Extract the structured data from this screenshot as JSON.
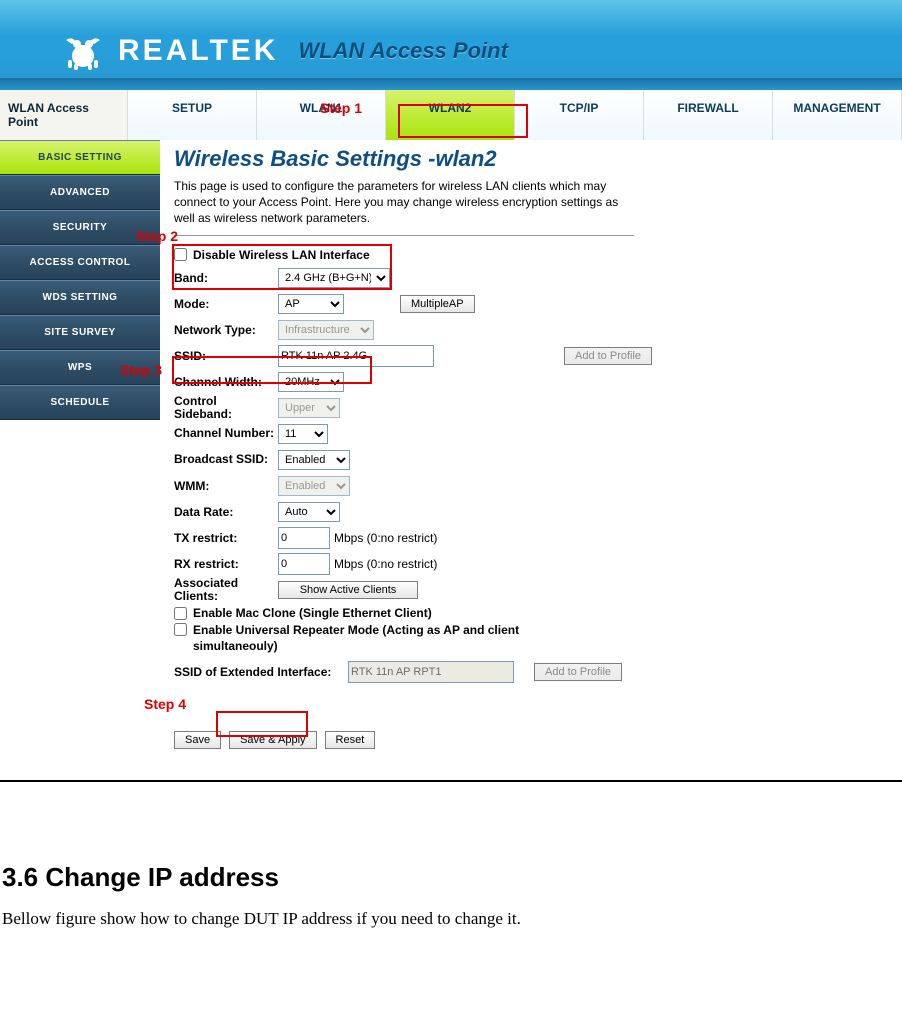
{
  "banner": {
    "brand": "REALTEK",
    "tagline": "WLAN Access Point"
  },
  "topnav": {
    "side_title": "WLAN Access Point",
    "tabs": [
      "SETUP",
      "WLAN1",
      "WLAN2",
      "TCP/IP",
      "FIREWALL",
      "MANAGEMENT"
    ]
  },
  "sidebar": {
    "items": [
      "BASIC SETTING",
      "ADVANCED",
      "SECURITY",
      "ACCESS CONTROL",
      "WDS SETTING",
      "SITE SURVEY",
      "WPS",
      "SCHEDULE"
    ]
  },
  "page": {
    "title": "Wireless Basic Settings -wlan2",
    "desc": "This page is used to configure the parameters for wireless LAN clients which may connect to your Access Point. Here you may change wireless encryption settings as well as wireless network parameters.",
    "disable_label": "Disable Wireless LAN Interface",
    "band_label": "Band:",
    "band_value": "2.4 GHz (B+G+N)",
    "mode_label": "Mode:",
    "mode_value": "AP",
    "multiple_ap": "MultipleAP",
    "nettype_label": "Network Type:",
    "nettype_value": "Infrastructure",
    "ssid_label": "SSID:",
    "ssid_value": "RTK 11n AP 2.4G",
    "add_to_profile": "Add to Profile",
    "chanw_label": "Channel Width:",
    "chanw_value": "20MHz",
    "sideband_label": "Control Sideband:",
    "sideband_value": "Upper",
    "channum_label": "Channel Number:",
    "channum_value": "11",
    "bssid_label": "Broadcast SSID:",
    "bssid_value": "Enabled",
    "wmm_label": "WMM:",
    "wmm_value": "Enabled",
    "rate_label": "Data Rate:",
    "rate_value": "Auto",
    "tx_label": "TX restrict:",
    "rx_label": "RX restrict:",
    "tx_value": "0",
    "rx_value": "0",
    "restrict_hint": "Mbps (0:no restrict)",
    "assoc_label": "Associated Clients:",
    "show_clients": "Show Active Clients",
    "macclone_label": "Enable Mac Clone (Single Ethernet Client)",
    "urepeater_label": "Enable Universal Repeater Mode (Acting as AP and client simultaneouly)",
    "ext_ssid_label": "SSID of Extended Interface:",
    "ext_ssid_value": "RTK 11n AP RPT1",
    "save": "Save",
    "save_apply": "Save & Apply",
    "reset": "Reset"
  },
  "steps": {
    "s1": "Step 1",
    "s2": "Step 2",
    "s3": "Step 3",
    "s4": "Step 4"
  },
  "doc": {
    "heading": "3.6 Change IP address",
    "body": "Bellow figure show how to change DUT IP address if you need to change it."
  }
}
